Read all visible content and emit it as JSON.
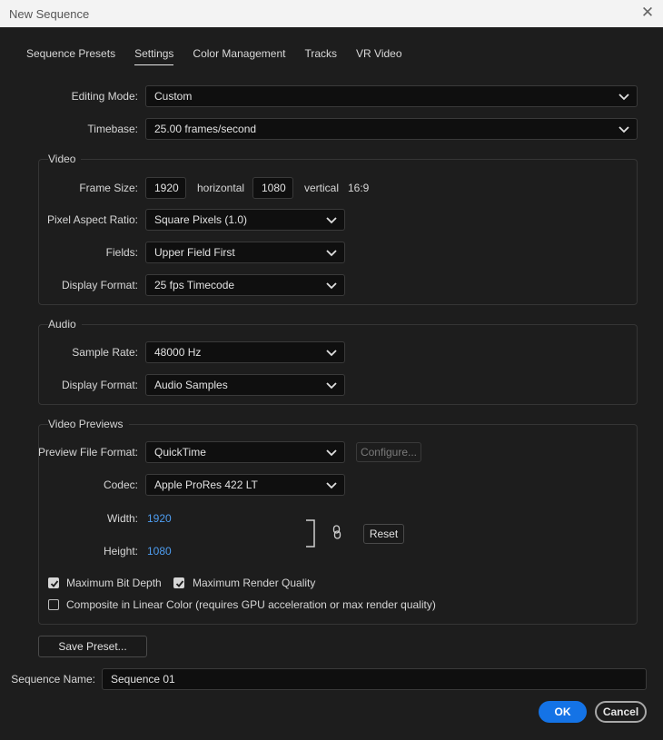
{
  "window": {
    "title": "New Sequence"
  },
  "tabs": [
    {
      "label": "Sequence Presets"
    },
    {
      "label": "Settings"
    },
    {
      "label": "Color Management"
    },
    {
      "label": "Tracks"
    },
    {
      "label": "VR Video"
    }
  ],
  "settings": {
    "editing_mode": {
      "label": "Editing Mode:",
      "value": "Custom"
    },
    "timebase": {
      "label": "Timebase:",
      "value": "25.00  frames/second"
    }
  },
  "video": {
    "title": "Video",
    "frame_size": {
      "label": "Frame Size:",
      "horizontal_value": "1920",
      "horizontal_label": "horizontal",
      "vertical_value": "1080",
      "vertical_label": "vertical",
      "aspect": "16:9"
    },
    "pixel_aspect": {
      "label": "Pixel Aspect Ratio:",
      "value": "Square Pixels (1.0)"
    },
    "fields": {
      "label": "Fields:",
      "value": "Upper Field First"
    },
    "display_format": {
      "label": "Display Format:",
      "value": "25 fps Timecode"
    }
  },
  "audio": {
    "title": "Audio",
    "sample_rate": {
      "label": "Sample Rate:",
      "value": "48000 Hz"
    },
    "display_format": {
      "label": "Display Format:",
      "value": "Audio Samples"
    }
  },
  "previews": {
    "title": "Video Previews",
    "file_format": {
      "label": "Preview File Format:",
      "value": "QuickTime"
    },
    "configure_label": "Configure...",
    "codec": {
      "label": "Codec:",
      "value": "Apple ProRes 422 LT"
    },
    "width": {
      "label": "Width:",
      "value": "1920"
    },
    "height": {
      "label": "Height:",
      "value": "1080"
    },
    "reset_label": "Reset",
    "max_bit_depth": {
      "label": "Maximum Bit Depth",
      "checked": true
    },
    "max_render_quality": {
      "label": "Maximum Render Quality",
      "checked": true
    },
    "linear_color": {
      "label": "Composite in Linear Color (requires GPU acceleration or max render quality)",
      "checked": false
    }
  },
  "footer": {
    "save_preset_label": "Save Preset...",
    "sequence_name_label": "Sequence Name:",
    "sequence_name_value": "Sequence 01",
    "ok_label": "OK",
    "cancel_label": "Cancel"
  },
  "colors": {
    "accent": "#1473e6",
    "link_value": "#4e9df0",
    "background": "#1d1d1d"
  },
  "icons": {
    "close": "close-icon",
    "dropdown": "chevron-down-icon",
    "link": "link-icon",
    "check": "checkmark-icon"
  }
}
